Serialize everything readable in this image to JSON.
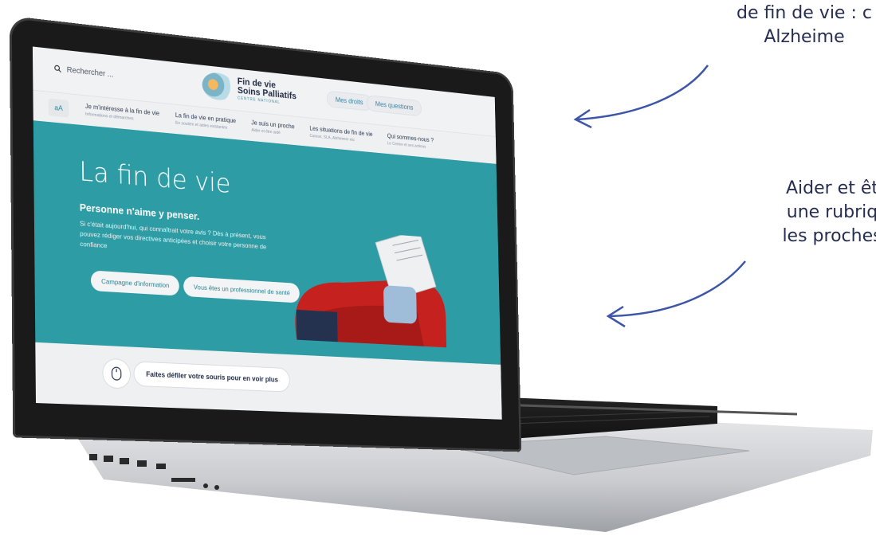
{
  "annotations": {
    "top": [
      "de fin de vie : c",
      "Alzheime"
    ],
    "middle": [
      "Aider et êt",
      "une rubriq",
      "les proches"
    ]
  },
  "site": {
    "search_placeholder": "Rechercher ...",
    "logo": {
      "line1": "Fin de vie",
      "line2": "Soins Palliatifs",
      "line3": "CENTRE NATIONAL"
    },
    "header_buttons": [
      "Mes droits",
      "Mes questions"
    ],
    "text_size_label": "aA",
    "nav": [
      {
        "label": "Je m'intéresse à la fin de vie",
        "sub": "Informations et démarches"
      },
      {
        "label": "La fin de vie en pratique",
        "sub": "En soutien et aides existantes"
      },
      {
        "label": "Je suis un proche",
        "sub": "Aider et être aidé"
      },
      {
        "label": "Les situations de fin de vie",
        "sub": "Cancer, SLA, Alzheimer etc"
      },
      {
        "label": "Qui sommes-nous ?",
        "sub": "Le Centre et ses actions"
      }
    ],
    "hero": {
      "title": "La fin de vie",
      "subtitle": "Personne n'aime y penser.",
      "text": "Si c'était aujourd'hui, qui connaîtrait votre avis ? Dès à présent, vous pouvez rédiger vos directives anticipées et choisir votre personne de confiance",
      "buttons": [
        "Campagne d'information",
        "Vous êtes un professionnel de santé"
      ]
    },
    "scroll_cta": "Faites défiler votre souris pour en voir plus"
  },
  "colors": {
    "hero_background": "#2e9ca4",
    "annotation_text": "#262f52",
    "armchair": "#c5211f"
  }
}
